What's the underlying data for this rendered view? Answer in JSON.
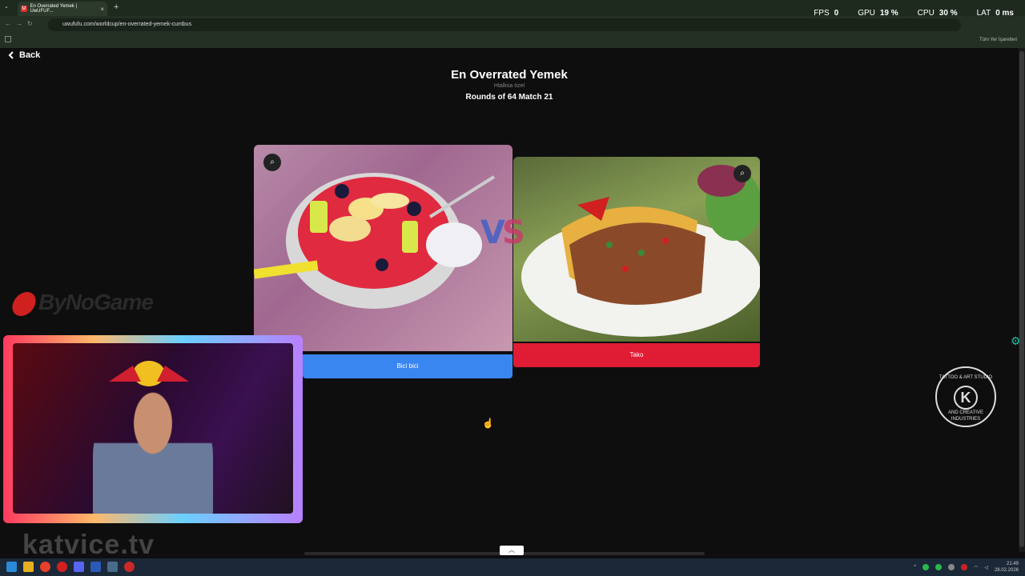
{
  "browser": {
    "tab_title": "En Overrated Yemek | UwUFUF...",
    "tab_close": "×",
    "new_tab": "+",
    "url": "uwufufu.com/worldcup/en-overrated-yemek-cumbus",
    "bookmarks_folder": "Tüm Yer İşaretleri"
  },
  "overlay_stats": [
    {
      "key": "FPS",
      "value": "0"
    },
    {
      "key": "GPU",
      "value": "19 %"
    },
    {
      "key": "CPU",
      "value": "30 %"
    },
    {
      "key": "LAT",
      "value": "0 ms"
    }
  ],
  "page": {
    "back_label": "Back",
    "title": "En Overrated Yemek",
    "subtitle": "Htalksa özel",
    "round_info": "Rounds of 64 Match 21"
  },
  "match": {
    "left_choice": "Bici bici",
    "right_choice": "Tako",
    "vs_v": "V",
    "vs_s": "S"
  },
  "stream": {
    "sponsor": "ByNoGame",
    "watermark": "katvice.tv",
    "tattoo_top": "TATTOO & ART STUDIO",
    "tattoo_letter": "K",
    "tattoo_bottom": "AND CREATIVE INDUSTRIES"
  },
  "taskbar": {
    "time": "21:49",
    "date": "28.02.2026"
  },
  "colors": {
    "left_button": "#3a86f0",
    "right_button": "#e01c34"
  }
}
